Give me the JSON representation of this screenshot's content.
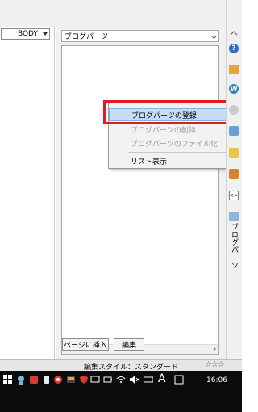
{
  "editor": {
    "element_select": "BODY"
  },
  "blog_parts": {
    "dropdown_label": "ブログパーツ",
    "insert_button": "ページに挿入",
    "edit_button": "編集"
  },
  "context_menu": {
    "items": [
      {
        "label": "ブログパーツの登録",
        "state": "highlighted"
      },
      {
        "label": "ブログパーツの削除",
        "state": "disabled"
      },
      {
        "label": "ブログパーツのファイル化",
        "state": "disabled"
      },
      {
        "label": "リスト表示",
        "state": "enabled"
      }
    ]
  },
  "side_panel": {
    "vertical_label": "ブログパーツ",
    "icons": [
      "help-icon",
      "image-icon",
      "w-icon",
      "globe-icon",
      "table-icon",
      "folder-icon",
      "pen-icon",
      "embed-icon",
      "blog-parts-icon"
    ]
  },
  "status": {
    "edit_style": "編集スタイル：スタンダード",
    "rating_stars": "☆☆☆"
  },
  "taskbar": {
    "ime_mode": "A",
    "clock": "16:06"
  },
  "colors": {
    "highlight_box": "#e01b24",
    "menu_highlight": "#c5dcf4"
  }
}
